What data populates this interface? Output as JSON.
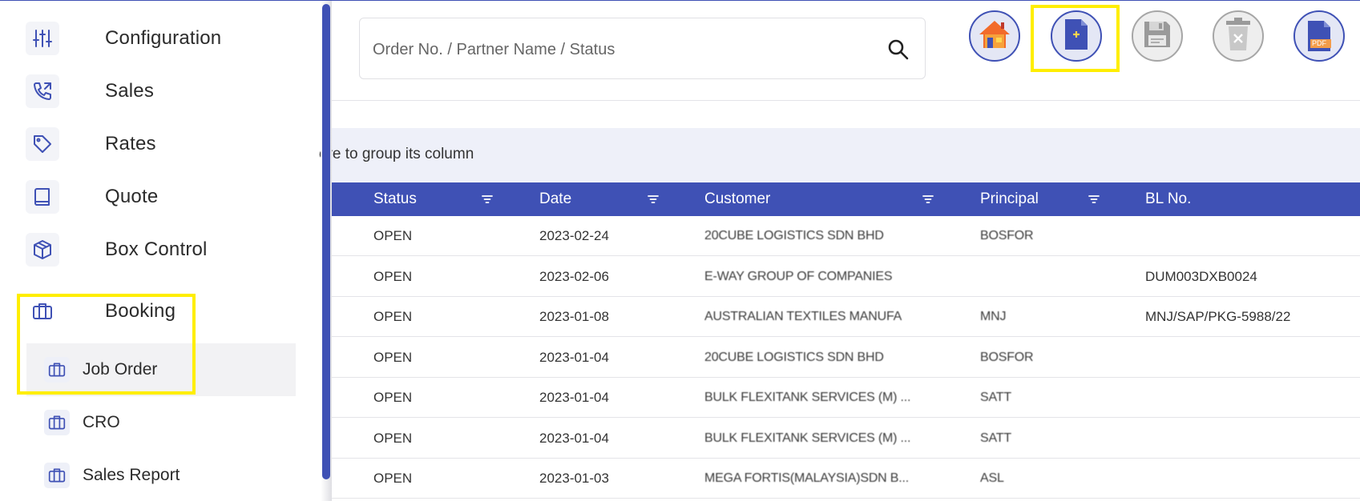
{
  "sidebar": {
    "items": [
      {
        "label": "Configuration",
        "icon": "sliders-icon"
      },
      {
        "label": "Sales",
        "icon": "phone-icon"
      },
      {
        "label": "Rates",
        "icon": "tag-icon"
      },
      {
        "label": "Quote",
        "icon": "book-icon"
      },
      {
        "label": "Box Control",
        "icon": "box-icon"
      },
      {
        "label": "Booking",
        "icon": "briefcase-icon"
      }
    ],
    "sub_items": [
      {
        "label": "Job Order",
        "icon": "briefcase-icon",
        "active": true
      },
      {
        "label": "CRO",
        "icon": "briefcase-icon"
      },
      {
        "label": "Sales Report",
        "icon": "briefcase-icon"
      }
    ]
  },
  "search": {
    "placeholder": "Order No. / Partner Name / Status",
    "value": ""
  },
  "toolbar": {
    "buttons": [
      "home-icon",
      "new-document-icon",
      "save-icon",
      "delete-icon",
      "pdf-icon"
    ],
    "pdf_label": "PDF"
  },
  "group_bar": {
    "text": "ere to group its column"
  },
  "grid": {
    "columns": [
      "Status",
      "Date",
      "Customer",
      "Principal",
      "BL No."
    ],
    "rows": [
      {
        "status": "OPEN",
        "date": "2023-02-24",
        "customer": "20CUBE LOGISTICS SDN BHD",
        "principal": "BOSFOR",
        "bl": ""
      },
      {
        "status": "OPEN",
        "date": "2023-02-06",
        "customer": "E-WAY GROUP OF COMPANIES",
        "principal": "",
        "bl": "DUM003DXB0024"
      },
      {
        "status": "OPEN",
        "date": "2023-01-08",
        "customer": "AUSTRALIAN TEXTILES MANUFA",
        "principal": "MNJ",
        "bl": "MNJ/SAP/PKG-5988/22"
      },
      {
        "status": "OPEN",
        "date": "2023-01-04",
        "customer": "20CUBE LOGISTICS SDN BHD",
        "principal": "BOSFOR",
        "bl": ""
      },
      {
        "status": "OPEN",
        "date": "2023-01-04",
        "customer": "BULK FLEXITANK SERVICES (M) ...",
        "principal": "SATT",
        "bl": ""
      },
      {
        "status": "OPEN",
        "date": "2023-01-04",
        "customer": "BULK FLEXITANK SERVICES (M) ...",
        "principal": "SATT",
        "bl": ""
      },
      {
        "status": "OPEN",
        "date": "2023-01-03",
        "customer": "MEGA FORTIS(MALAYSIA)SDN B...",
        "principal": "ASL",
        "bl": ""
      }
    ]
  },
  "colors": {
    "accent": "#3f51b5",
    "highlight": "#ffee00",
    "group_bar": "#eef0f9"
  }
}
